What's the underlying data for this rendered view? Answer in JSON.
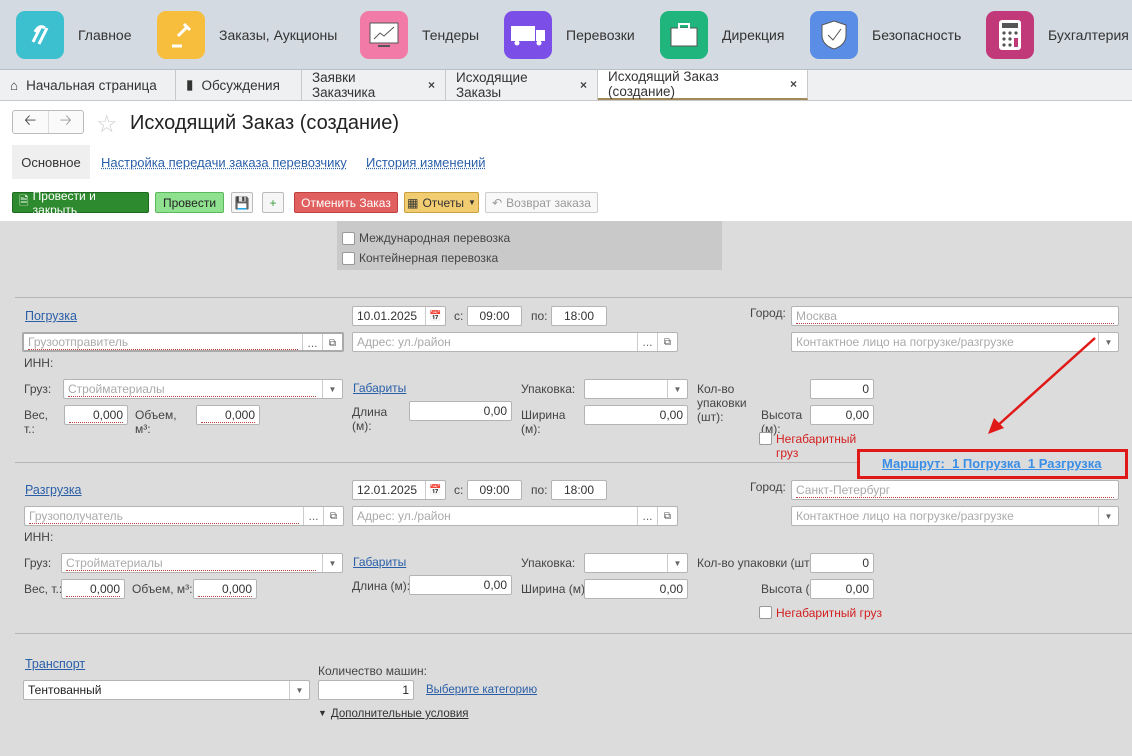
{
  "sections": [
    {
      "label": "Главное",
      "icon": "logo-icon",
      "color": "#3cbfcf"
    },
    {
      "label": "Заказы, Аукционы",
      "icon": "gavel-icon",
      "color": "#f7be3d"
    },
    {
      "label": "Тендеры",
      "icon": "chart-monitor-icon",
      "color": "#f27aa6"
    },
    {
      "label": "Перевозки",
      "icon": "truck-icon",
      "color": "#7b4ee8"
    },
    {
      "label": "Дирекция",
      "icon": "briefcase-icon",
      "color": "#1fb57c"
    },
    {
      "label": "Безопасность",
      "icon": "shield-icon",
      "color": "#5a8de6"
    },
    {
      "label": "Бухгалтерия",
      "icon": "calculator-icon",
      "color": "#c2397a"
    }
  ],
  "tabs": [
    {
      "label": "Начальная страница",
      "icon": "home-icon"
    },
    {
      "label": "Обсуждения",
      "icon": "chat-icon"
    },
    {
      "label": "Заявки Заказчика",
      "close": "×"
    },
    {
      "label": "Исходящие Заказы",
      "close": "×"
    },
    {
      "label": "Исходящий Заказ (создание)",
      "close": "×"
    }
  ],
  "title": "Исходящий Заказ (создание)",
  "form_tabs": [
    "Основное",
    "Настройка передачи заказа перевозчику",
    "История изменений"
  ],
  "toolbar": {
    "post_close": "Провести и закрыть",
    "post": "Провести",
    "cancel": "Отменить Заказ",
    "reports": "Отчеты",
    "return": "Возврат заказа"
  },
  "options": {
    "international": "Международная перевозка",
    "container": "Контейнерная перевозка"
  },
  "loading": {
    "title": "Погрузка",
    "date": "10.01.2025",
    "from": "09:00",
    "to": "18:00",
    "city": "Москва",
    "party_ph": "Грузоотправитель",
    "cargo": "Стройматериалы",
    "weight": "0,000",
    "volume": "0,000",
    "length": "0,00",
    "width": "0,00",
    "height": "0,00",
    "pack_count": "0"
  },
  "unloading": {
    "title": "Разгрузка",
    "date": "12.01.2025",
    "from": "09:00",
    "to": "18:00",
    "city": "Санкт-Петербург",
    "party_ph": "Грузополучатель",
    "cargo": "Стройматериалы",
    "weight": "0,000",
    "volume": "0,000",
    "length": "0,00",
    "width": "0,00",
    "height": "0,00",
    "pack_count": "0"
  },
  "labels": {
    "from": "с:",
    "to": "по:",
    "city": "Город:",
    "address_ph": "Адрес: ул./район",
    "contact_ph": "Контактное лицо на погрузке/разгрузке",
    "inn": "ИНН:",
    "cargo": "Груз:",
    "dims": "Габариты",
    "pack": "Упаковка:",
    "pack_count": "Кол-во упаковки (шт):",
    "weight": "Вес, т.:",
    "volume": "Объем, м³:",
    "length": "Длина (м):",
    "width": "Ширина (м):",
    "height": "Высота (м):",
    "oversize": "Негабаритный груз",
    "dots": "..."
  },
  "route": "Маршрут:  1 Погрузка  1 Разгрузка",
  "transport": {
    "title": "Транспорт",
    "type": "Тентованный",
    "count_label": "Количество машин:",
    "count": "1",
    "category": "Выберите категорию",
    "extra": "Дополнительные условия"
  }
}
